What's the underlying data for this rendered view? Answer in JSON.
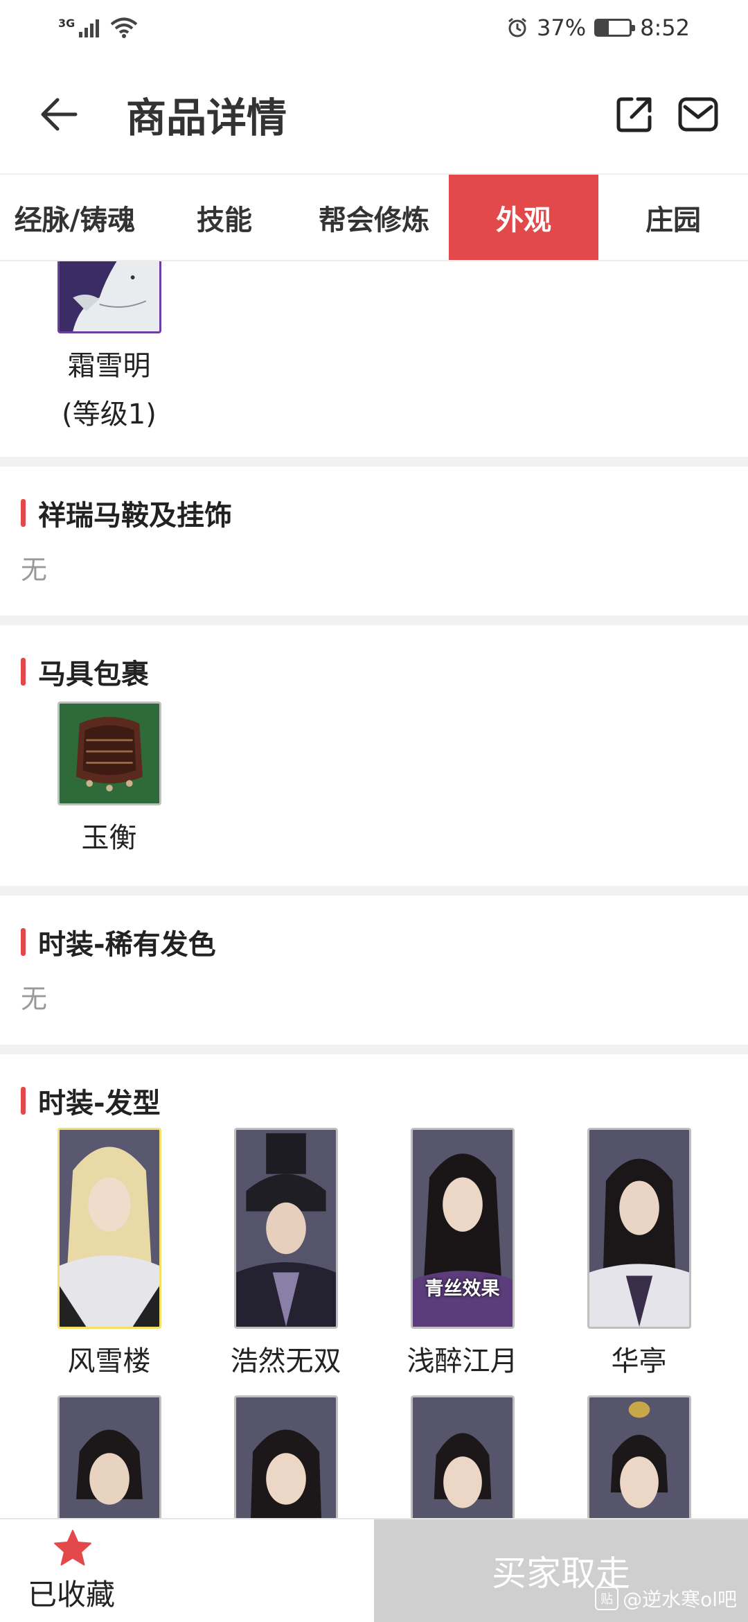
{
  "status_bar": {
    "network": "3G",
    "battery_percent": "37%",
    "battery_level": 0.37,
    "time": "8:52"
  },
  "header": {
    "title": "商品详情"
  },
  "tabs": [
    {
      "label": "经脉/铸魂",
      "active": false
    },
    {
      "label": "技能",
      "active": false
    },
    {
      "label": "帮会修炼",
      "active": false
    },
    {
      "label": "外观",
      "active": true
    },
    {
      "label": "庄园",
      "active": false
    }
  ],
  "mount_section": {
    "item_name": "霜雪明",
    "item_level": "(等级1)"
  },
  "sections": {
    "saddle": {
      "title": "祥瑞马鞍及挂饰",
      "value": "无"
    },
    "harness": {
      "title": "马具包裹",
      "item_name": "玉衡"
    },
    "rare_hair_color": {
      "title": "时装-稀有发色",
      "value": "无"
    },
    "hairstyle": {
      "title": "时装-发型",
      "items": [
        {
          "name": "风雪楼",
          "tag": ""
        },
        {
          "name": "浩然无双",
          "tag": ""
        },
        {
          "name": "浅醉江月",
          "tag": "青丝效果"
        },
        {
          "name": "华亭",
          "tag": ""
        },
        {
          "name": "",
          "tag": ""
        },
        {
          "name": "",
          "tag": ""
        },
        {
          "name": "",
          "tag": ""
        },
        {
          "name": "",
          "tag": ""
        }
      ]
    }
  },
  "bottom": {
    "favorite_label": "已收藏",
    "buy_label": "买家取走",
    "watermark": "@逆水寒ol吧",
    "watermark_icon": "贴"
  },
  "colors": {
    "accent": "#e3494a",
    "disabled": "#cfcfcf"
  }
}
